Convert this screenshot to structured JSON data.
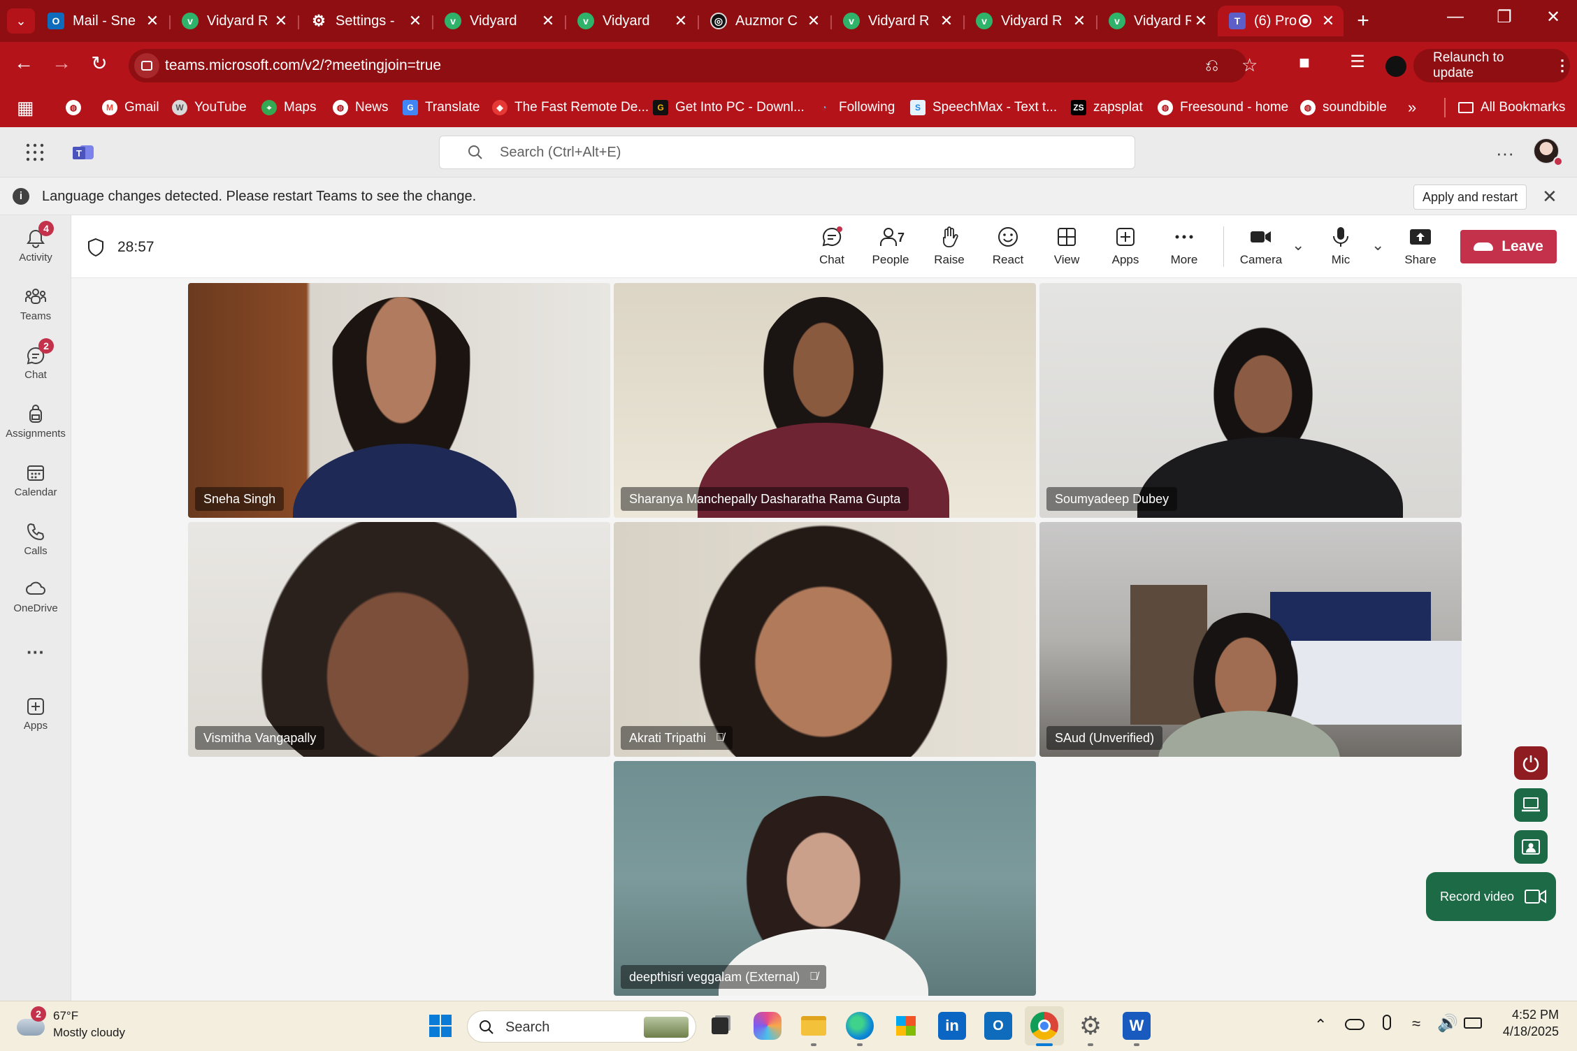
{
  "browser": {
    "tabs": [
      {
        "title": "Mail - Sne",
        "icon": "outlook-icon"
      },
      {
        "title": "Vidyard R",
        "icon": "vidyard-icon"
      },
      {
        "title": "Settings -",
        "icon": "gear-icon"
      },
      {
        "title": "Vidyard",
        "icon": "vidyard-icon"
      },
      {
        "title": "Vidyard",
        "icon": "vidyard-icon"
      },
      {
        "title": "Auzmor C",
        "icon": "openai-icon"
      },
      {
        "title": "Vidyard R",
        "icon": "vidyard-icon"
      },
      {
        "title": "Vidyard R",
        "icon": "vidyard-icon"
      },
      {
        "title": "Vidyard R",
        "icon": "vidyard-icon"
      },
      {
        "title": "(6) Pro",
        "icon": "teams-icon"
      }
    ],
    "url": "teams.microsoft.com/v2/?meetingjoin=true",
    "relaunch_label": "Relaunch to update",
    "bookmarks": [
      {
        "label": "Gmail"
      },
      {
        "label": "YouTube"
      },
      {
        "label": "Maps"
      },
      {
        "label": "News"
      },
      {
        "label": "Translate"
      },
      {
        "label": "The Fast Remote De..."
      },
      {
        "label": "Get Into PC - Downl..."
      },
      {
        "label": "Following"
      },
      {
        "label": "SpeechMax - Text t..."
      },
      {
        "label": "zapsplat"
      },
      {
        "label": "Freesound - home"
      },
      {
        "label": "soundbible"
      }
    ],
    "more_bookmarks": "»",
    "all_bookmarks": "All Bookmarks"
  },
  "teams": {
    "search_placeholder": "Search (Ctrl+Alt+E)",
    "banner_text": "Language changes detected. Please restart Teams to see the change.",
    "banner_button": "Apply and restart",
    "rail": [
      {
        "label": "Activity",
        "badge": "4"
      },
      {
        "label": "Teams",
        "badge": ""
      },
      {
        "label": "Chat",
        "badge": "2"
      },
      {
        "label": "Assignments",
        "badge": ""
      },
      {
        "label": "Calendar",
        "badge": ""
      },
      {
        "label": "Calls",
        "badge": ""
      },
      {
        "label": "OneDrive",
        "badge": ""
      },
      {
        "label": "Apps",
        "badge": ""
      }
    ],
    "rail_more": "···",
    "meeting": {
      "timer": "28:57",
      "people_count": "7",
      "controls": {
        "chat": "Chat",
        "people": "People",
        "raise": "Raise",
        "react": "React",
        "view": "View",
        "apps": "Apps",
        "more": "More",
        "camera": "Camera",
        "mic": "Mic",
        "share": "Share"
      },
      "leave_label": "Leave",
      "participants": [
        {
          "name": "Sneha Singh",
          "muted": false
        },
        {
          "name": "Sharanya Manchepally Dasharatha Rama Gupta",
          "muted": false
        },
        {
          "name": "Soumyadeep Dubey",
          "muted": false
        },
        {
          "name": "Vismitha Vangapally",
          "muted": false
        },
        {
          "name": "Akrati Tripathi",
          "muted": true
        },
        {
          "name": "SAud (Unverified)",
          "muted": false
        },
        {
          "name": "deepthisri veggalam (External)",
          "muted": true
        }
      ],
      "record_video_label": "Record video"
    }
  },
  "taskbar": {
    "weather_temp": "67°F",
    "weather_desc": "Mostly cloudy",
    "weather_badge": "2",
    "search_label": "Search",
    "time": "4:52 PM",
    "date": "4/18/2025"
  }
}
